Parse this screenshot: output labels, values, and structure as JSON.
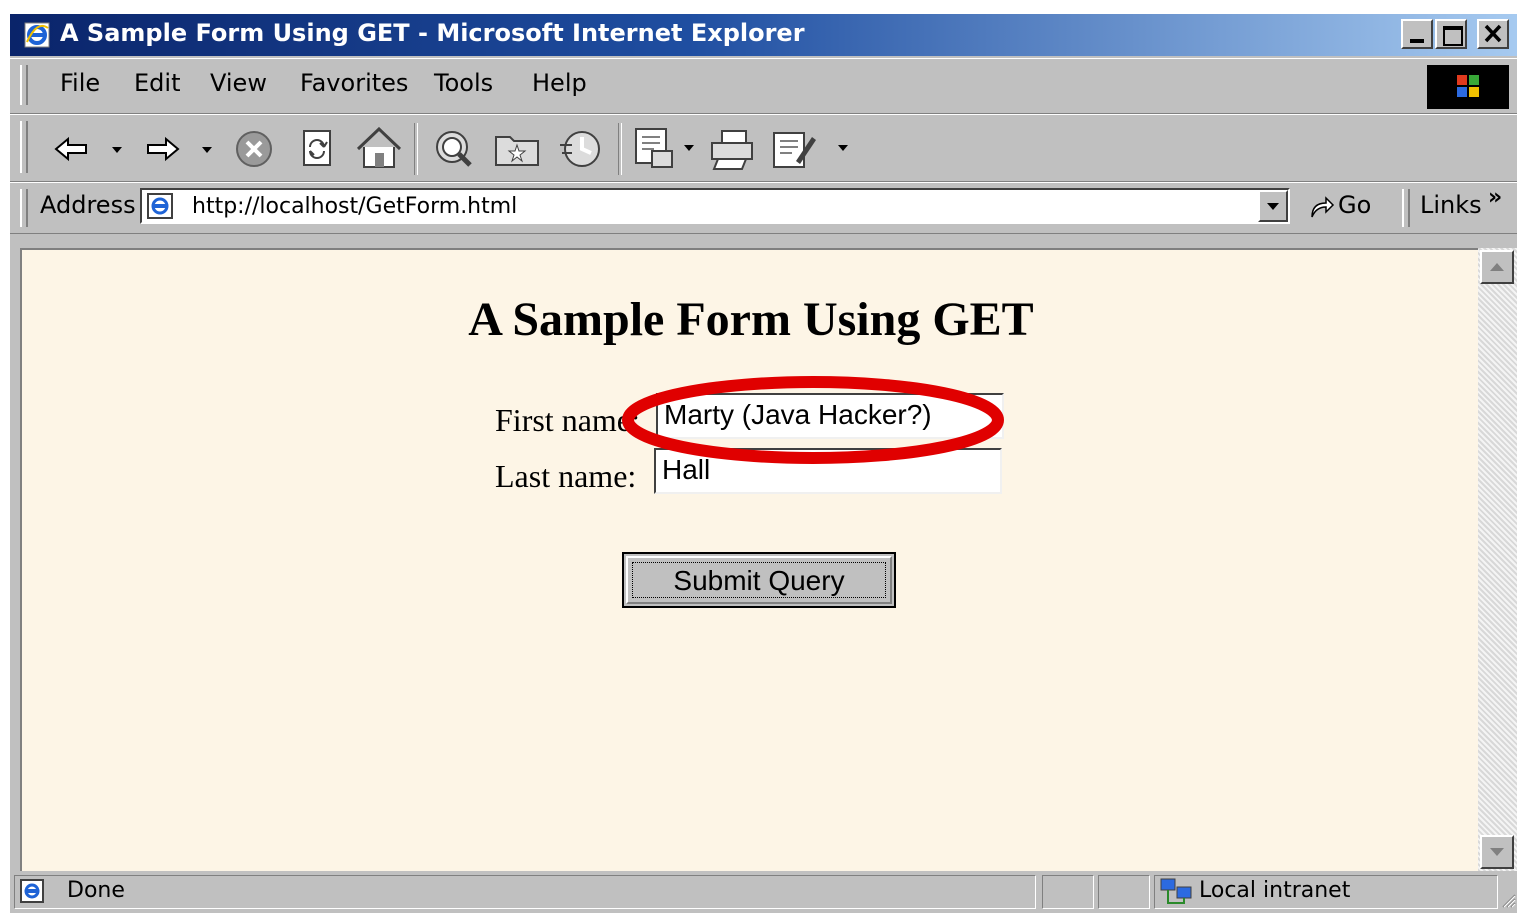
{
  "window": {
    "title": "A Sample Form Using GET - Microsoft Internet Explorer"
  },
  "menu": {
    "items": [
      "File",
      "Edit",
      "View",
      "Favorites",
      "Tools",
      "Help"
    ]
  },
  "toolbar": {
    "icons": [
      "back-icon",
      "forward-icon",
      "stop-icon",
      "refresh-icon",
      "home-icon",
      "search-icon",
      "favorites-icon",
      "history-icon",
      "mail-icon",
      "print-icon",
      "edit-icon"
    ]
  },
  "address_bar": {
    "label": "Address",
    "url": "http://localhost/GetForm.html",
    "go_label": "Go",
    "links_label": "Links"
  },
  "page": {
    "heading": "A Sample Form Using GET",
    "first_name_label": "First name:",
    "first_name_value": "Marty (Java Hacker?)",
    "last_name_label": "Last name:",
    "last_name_value": "Hall",
    "submit_label": "Submit Query",
    "highlight_color": "#e00000"
  },
  "status_bar": {
    "text": "Done",
    "zone": "Local intranet"
  },
  "colors": {
    "titlebar_start": "#0a246a",
    "titlebar_end": "#a6caf0",
    "chrome": "#c0c0c0",
    "page_background": "#fdf5e6"
  }
}
